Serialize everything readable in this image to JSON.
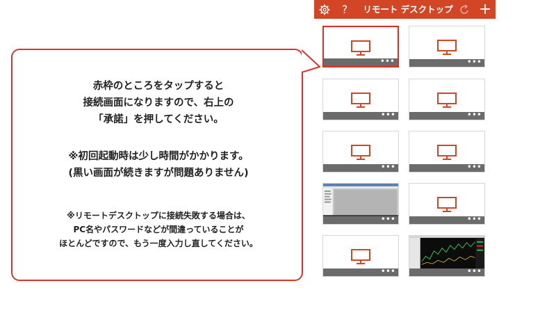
{
  "header": {
    "title": "リモート デスクトップ",
    "settings_icon": "gear-icon",
    "help_label": "?",
    "refresh_icon": "refresh-icon",
    "add_label": "+"
  },
  "callout": {
    "paragraph1": [
      "赤枠のところをタップすると",
      "接続画面になりますので、右上の",
      "「承諾」を押してください。"
    ],
    "paragraph2": [
      "※初回起動時は少し時間がかかります。",
      "(黒い画面が続きますが問題ありません)"
    ],
    "paragraph3": [
      "※リモートデスクトップに接続失敗する場合は、",
      "PC名やパスワードなどが間違っていることが",
      "ほとんどですので、もう一度入力し直してください。"
    ]
  },
  "tiles": [
    {
      "kind": "monitor",
      "selected": true,
      "more": "•••"
    },
    {
      "kind": "monitor",
      "selected": false,
      "more": "•••"
    },
    {
      "kind": "monitor",
      "selected": false,
      "more": "•••"
    },
    {
      "kind": "monitor",
      "selected": false,
      "more": "•••"
    },
    {
      "kind": "monitor",
      "selected": false,
      "more": "•••"
    },
    {
      "kind": "monitor",
      "selected": false,
      "more": "•••"
    },
    {
      "kind": "screenshot-desktop",
      "selected": false,
      "more": "•••"
    },
    {
      "kind": "monitor",
      "selected": false,
      "more": "•••"
    },
    {
      "kind": "monitor",
      "selected": false,
      "more": "•••"
    },
    {
      "kind": "screenshot-trading",
      "selected": false,
      "more": "•••"
    }
  ],
  "colors": {
    "accent": "#d24625",
    "highlight": "#e02d22",
    "tile_bar": "#6b6b6b"
  }
}
